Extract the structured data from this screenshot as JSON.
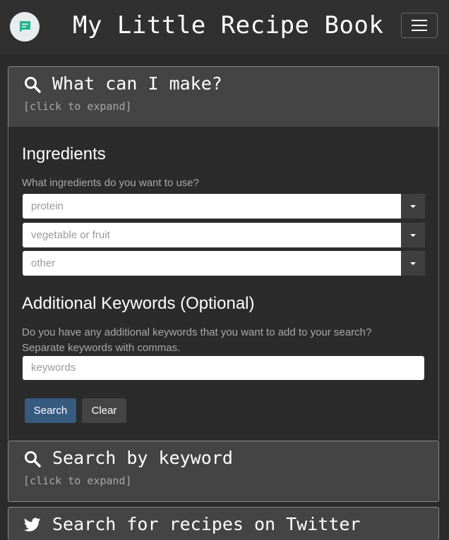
{
  "navbar": {
    "brand": "My Little Recipe Book",
    "logo_icon": "chat-bubble-icon",
    "menu_icon": "hamburger-menu-icon",
    "accent_color": "#1fb58f"
  },
  "cards": {
    "what_can_i_make": {
      "icon": "search-icon",
      "title": "What can I make?",
      "subtitle": "[click to expand]"
    },
    "search_keyword": {
      "icon": "search-icon",
      "title": "Search by keyword",
      "subtitle": "[click to expand]"
    },
    "search_twitter": {
      "icon": "twitter-icon",
      "title": "Search for recipes on Twitter"
    }
  },
  "ingredients": {
    "heading": "Ingredients",
    "help": "What ingredients do you want to use?",
    "selects": [
      {
        "placeholder": "protein"
      },
      {
        "placeholder": "vegetable or fruit"
      },
      {
        "placeholder": "other"
      }
    ]
  },
  "keywords": {
    "heading": "Additional Keywords (Optional)",
    "help_line1": "Do you have any additional keywords that you want to add to your search?",
    "help_line2": "Separate keywords with commas.",
    "placeholder": "keywords"
  },
  "buttons": {
    "search": "Search",
    "clear": "Clear",
    "search_color": "#375a7f",
    "clear_color": "#444444"
  }
}
